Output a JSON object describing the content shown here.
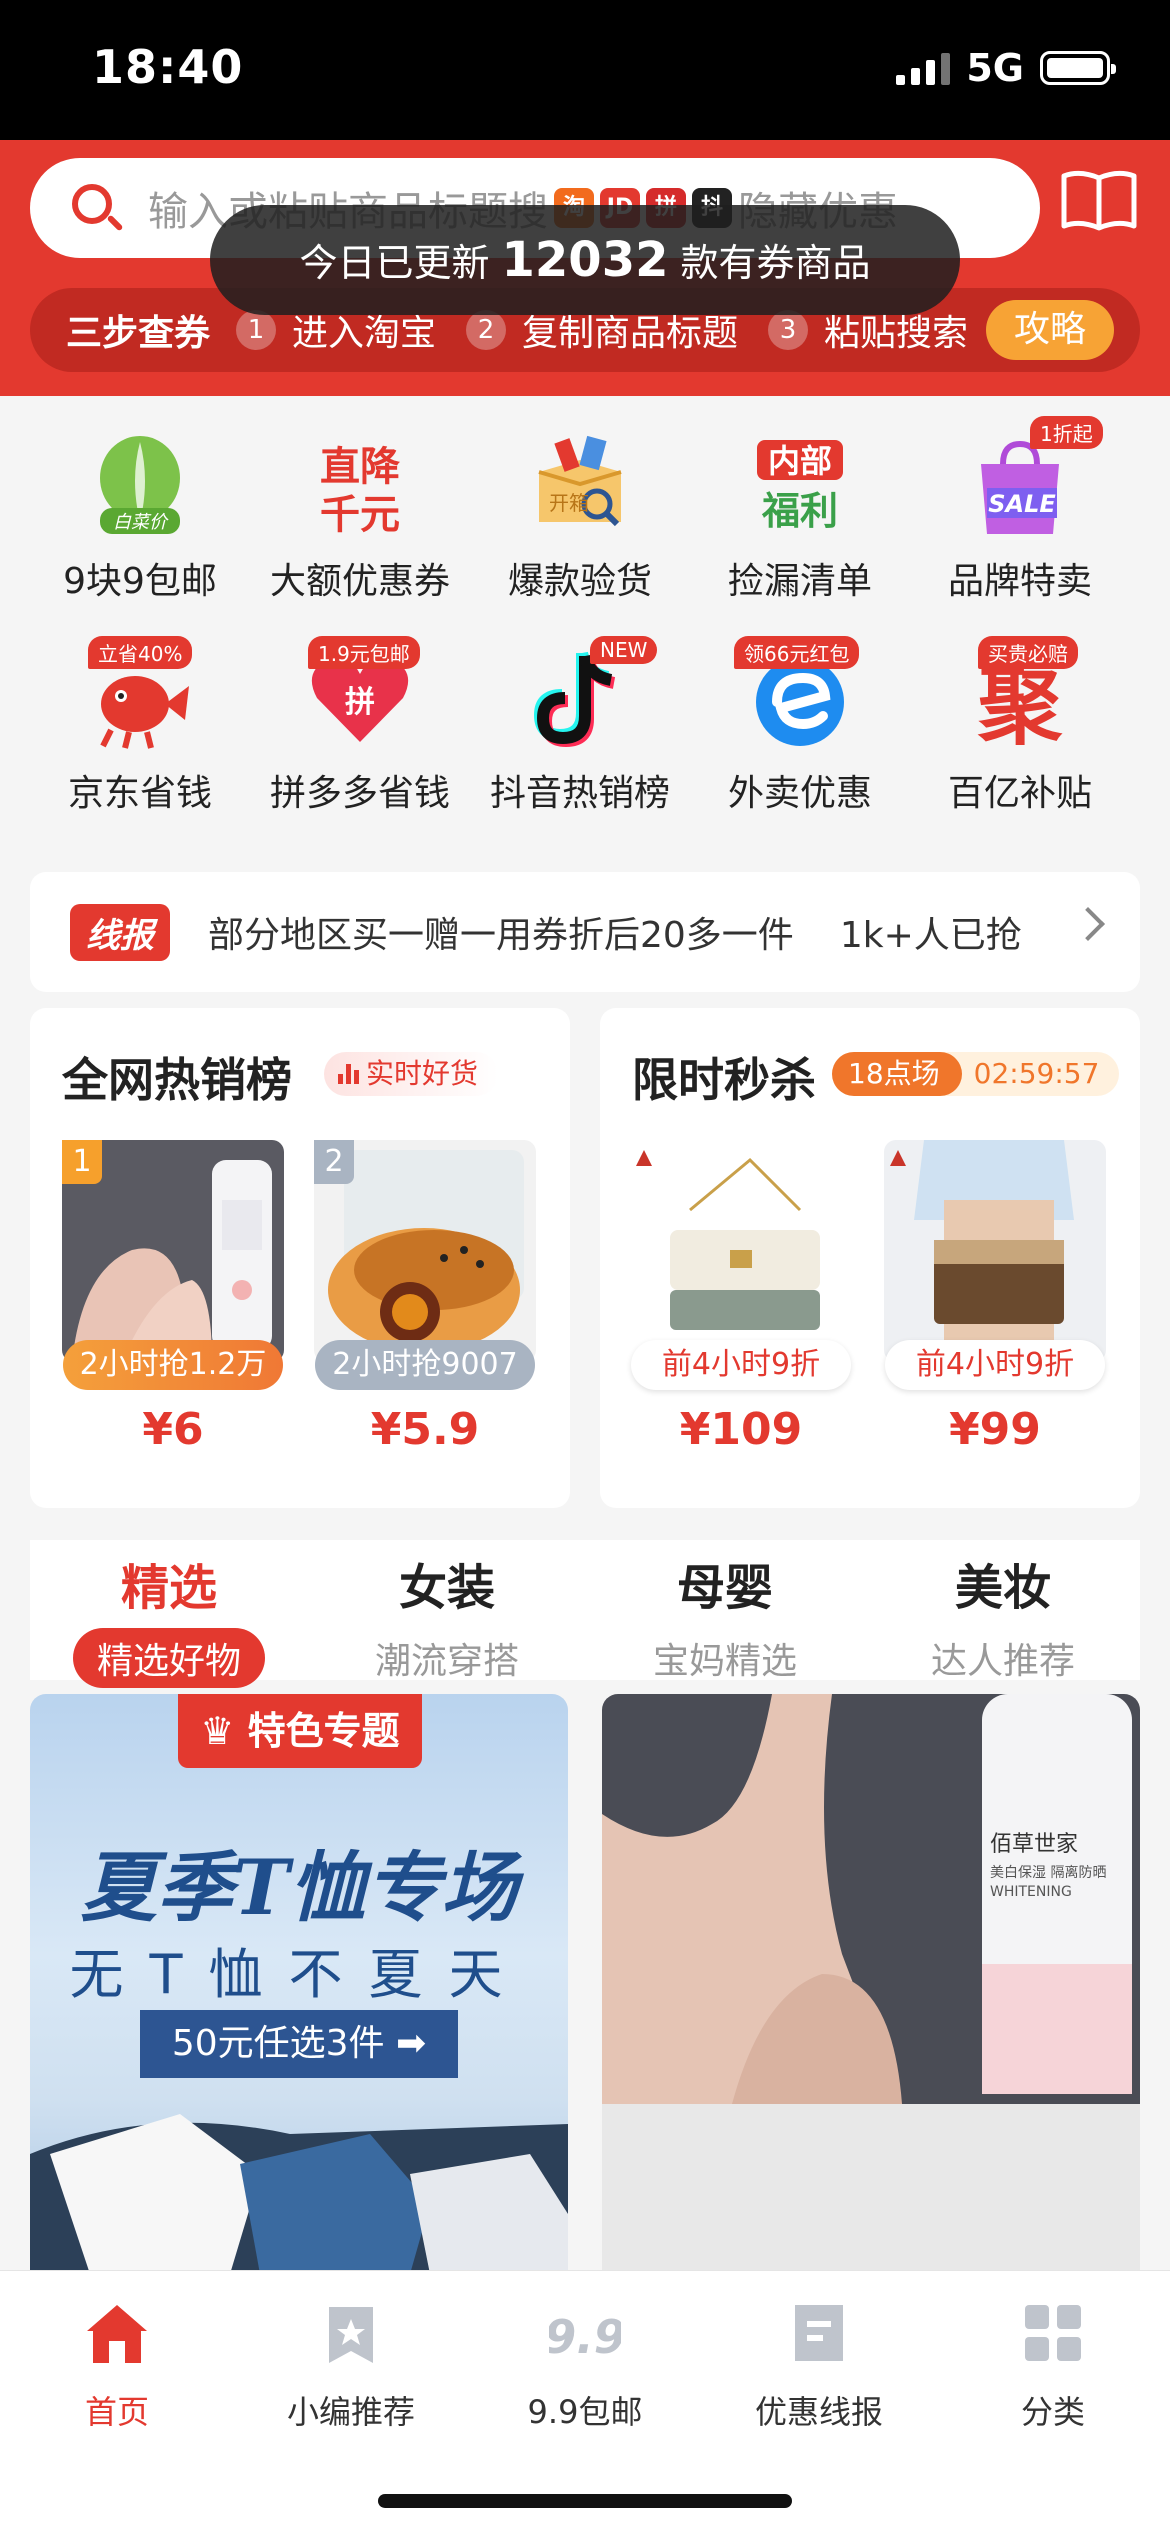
{
  "status_bar": {
    "time": "18:40",
    "network": "5G"
  },
  "search": {
    "placeholder_prefix": "输入或粘贴商品标题搜",
    "platform_badges": [
      "淘",
      "JD",
      "拼",
      "抖"
    ],
    "placeholder_suffix": "隐藏优惠"
  },
  "toast": {
    "prefix": "今日已更新",
    "count": "12032",
    "suffix": "款有券商品"
  },
  "steps": {
    "title": "三步查券",
    "items": [
      {
        "num": "1",
        "label": "进入淘宝"
      },
      {
        "num": "2",
        "label": "复制商品标题"
      },
      {
        "num": "3",
        "label": "粘贴搜索"
      }
    ],
    "guide_button": "攻略"
  },
  "grid": [
    {
      "label": "9块9包邮",
      "badge": "",
      "icon_text": "白菜价"
    },
    {
      "label": "大额优惠券",
      "badge": "",
      "icon_text": "直降千元"
    },
    {
      "label": "爆款验货",
      "badge": "",
      "icon_text": "开箱"
    },
    {
      "label": "捡漏清单",
      "badge": "",
      "icon_text": "内部福利"
    },
    {
      "label": "品牌特卖",
      "badge": "1折起",
      "icon_text": "SALE"
    },
    {
      "label": "京东省钱",
      "badge": "立省40%",
      "icon_text": ""
    },
    {
      "label": "拼多多省钱",
      "badge": "1.9元包邮",
      "icon_text": "拼"
    },
    {
      "label": "抖音热销榜",
      "badge": "NEW",
      "icon_text": ""
    },
    {
      "label": "外卖优惠",
      "badge": "领66元红包",
      "icon_text": ""
    },
    {
      "label": "百亿补贴",
      "badge": "买贵必赔",
      "icon_text": "聚"
    }
  ],
  "news": {
    "badge": "线报",
    "text": "部分地区买一赠一用券折后20多一件",
    "count": "1k+人已抢"
  },
  "hot_card": {
    "title": "全网热销榜",
    "tag": "实时好货",
    "products": [
      {
        "rank": "1",
        "tag": "2小时抢1.2万",
        "price": "¥6"
      },
      {
        "rank": "2",
        "tag": "2小时抢9007",
        "price": "¥5.9"
      }
    ]
  },
  "flash_card": {
    "title": "限时秒杀",
    "session": "18点场",
    "countdown": "02:59:57",
    "products": [
      {
        "tag": "前4小时9折",
        "price": "¥109"
      },
      {
        "tag": "前4小时9折",
        "price": "¥99"
      }
    ]
  },
  "tabs": [
    {
      "title": "精选",
      "sub": "精选好物"
    },
    {
      "title": "女装",
      "sub": "潮流穿搭"
    },
    {
      "title": "母婴",
      "sub": "宝妈精选"
    },
    {
      "title": "美妆",
      "sub": "达人推荐"
    }
  ],
  "feed": {
    "feature_badge": "特色专题",
    "promo_title": "夏季T恤专场",
    "promo_sub": "无T恤不夏天",
    "promo_button": "50元任选3件 ➡",
    "product_brand": "佰草世家",
    "product_line1": "美白保湿 隔离防晒",
    "product_line2": "WHITENING"
  },
  "bottom_nav": [
    {
      "label": "首页"
    },
    {
      "label": "小编推荐"
    },
    {
      "label": "9.9包邮",
      "icon_text": "9.9"
    },
    {
      "label": "优惠线报"
    },
    {
      "label": "分类"
    }
  ],
  "colors": {
    "brand_red": "#e3392f",
    "orange": "#f0762b",
    "blue": "#1f4e8c"
  }
}
